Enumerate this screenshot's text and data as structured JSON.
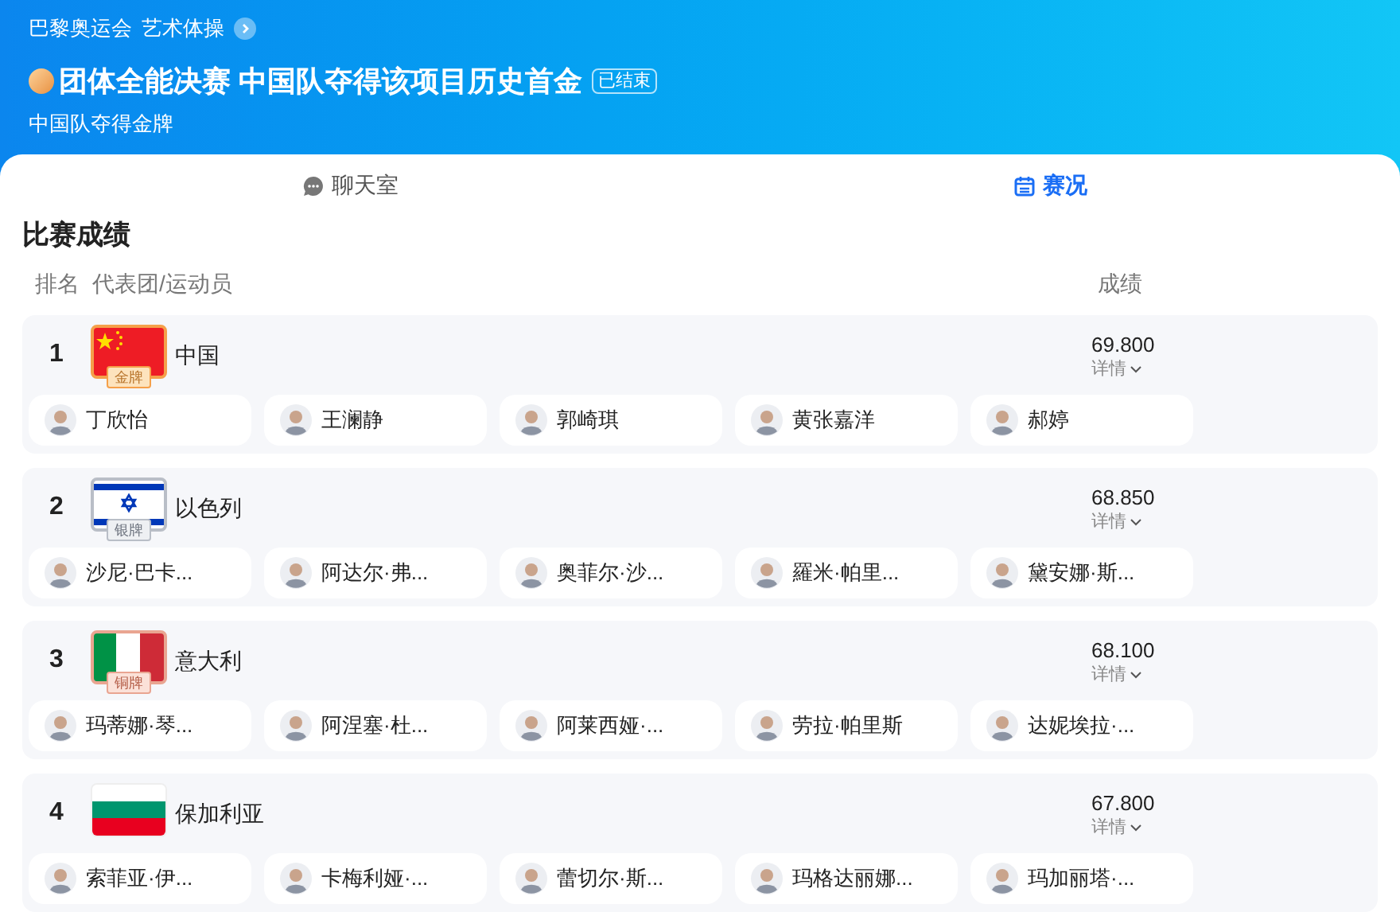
{
  "header": {
    "breadcrumb": [
      "巴黎奥运会",
      "艺术体操"
    ],
    "title": "团体全能决赛 中国队夺得该项目历史首金",
    "status_badge": "已结束",
    "subtitle": "中国队夺得金牌"
  },
  "tabs": [
    {
      "label": "聊天室",
      "selected": false
    },
    {
      "label": "赛况",
      "selected": true
    }
  ],
  "section_title": "比赛成绩",
  "columns": [
    "排名",
    "代表团/运动员",
    "成绩"
  ],
  "results": [
    {
      "rank": "1",
      "team": "中国",
      "flag": {
        "kind": "china"
      },
      "medal": {
        "kind": "gold",
        "label": "金牌"
      },
      "score": "69.800",
      "details": "详情",
      "athletes": [
        "丁欣怡",
        "王澜静",
        "郭崎琪",
        "黄张嘉洋",
        "郝婷"
      ]
    },
    {
      "rank": "2",
      "team": "以色列",
      "flag": {
        "kind": "israel"
      },
      "medal": {
        "kind": "silver",
        "label": "银牌"
      },
      "score": "68.850",
      "details": "详情",
      "athletes": [
        "沙尼·巴卡...",
        "阿达尔·弗...",
        "奥菲尔·沙...",
        "羅米·帕里...",
        "黛安娜·斯..."
      ]
    },
    {
      "rank": "3",
      "team": "意大利",
      "flag": {
        "kind": "italy"
      },
      "medal": {
        "kind": "bronze",
        "label": "铜牌"
      },
      "score": "68.100",
      "details": "详情",
      "athletes": [
        "玛蒂娜·琴...",
        "阿涅塞·杜...",
        "阿莱西娅·...",
        "劳拉·帕里斯",
        "达妮埃拉·..."
      ]
    },
    {
      "rank": "4",
      "team": "保加利亚",
      "flag": {
        "kind": "bulgaria"
      },
      "score": "67.800",
      "details": "详情",
      "athletes": [
        "索菲亚·伊...",
        "卡梅利娅·...",
        "蕾切尔·斯...",
        "玛格达丽娜...",
        "玛加丽塔·..."
      ]
    }
  ]
}
